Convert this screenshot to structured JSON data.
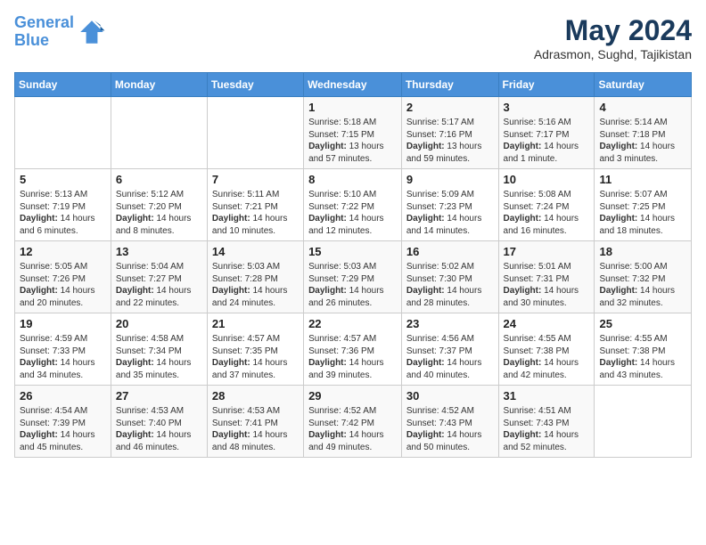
{
  "header": {
    "logo_line1": "General",
    "logo_line2": "Blue",
    "month_year": "May 2024",
    "location": "Adrasmon, Sughd, Tajikistan"
  },
  "weekdays": [
    "Sunday",
    "Monday",
    "Tuesday",
    "Wednesday",
    "Thursday",
    "Friday",
    "Saturday"
  ],
  "weeks": [
    [
      {
        "day": "",
        "info": ""
      },
      {
        "day": "",
        "info": ""
      },
      {
        "day": "",
        "info": ""
      },
      {
        "day": "1",
        "info": "Sunrise: 5:18 AM\nSunset: 7:15 PM\nDaylight: 13 hours and 57 minutes."
      },
      {
        "day": "2",
        "info": "Sunrise: 5:17 AM\nSunset: 7:16 PM\nDaylight: 13 hours and 59 minutes."
      },
      {
        "day": "3",
        "info": "Sunrise: 5:16 AM\nSunset: 7:17 PM\nDaylight: 14 hours and 1 minute."
      },
      {
        "day": "4",
        "info": "Sunrise: 5:14 AM\nSunset: 7:18 PM\nDaylight: 14 hours and 3 minutes."
      }
    ],
    [
      {
        "day": "5",
        "info": "Sunrise: 5:13 AM\nSunset: 7:19 PM\nDaylight: 14 hours and 6 minutes."
      },
      {
        "day": "6",
        "info": "Sunrise: 5:12 AM\nSunset: 7:20 PM\nDaylight: 14 hours and 8 minutes."
      },
      {
        "day": "7",
        "info": "Sunrise: 5:11 AM\nSunset: 7:21 PM\nDaylight: 14 hours and 10 minutes."
      },
      {
        "day": "8",
        "info": "Sunrise: 5:10 AM\nSunset: 7:22 PM\nDaylight: 14 hours and 12 minutes."
      },
      {
        "day": "9",
        "info": "Sunrise: 5:09 AM\nSunset: 7:23 PM\nDaylight: 14 hours and 14 minutes."
      },
      {
        "day": "10",
        "info": "Sunrise: 5:08 AM\nSunset: 7:24 PM\nDaylight: 14 hours and 16 minutes."
      },
      {
        "day": "11",
        "info": "Sunrise: 5:07 AM\nSunset: 7:25 PM\nDaylight: 14 hours and 18 minutes."
      }
    ],
    [
      {
        "day": "12",
        "info": "Sunrise: 5:05 AM\nSunset: 7:26 PM\nDaylight: 14 hours and 20 minutes."
      },
      {
        "day": "13",
        "info": "Sunrise: 5:04 AM\nSunset: 7:27 PM\nDaylight: 14 hours and 22 minutes."
      },
      {
        "day": "14",
        "info": "Sunrise: 5:03 AM\nSunset: 7:28 PM\nDaylight: 14 hours and 24 minutes."
      },
      {
        "day": "15",
        "info": "Sunrise: 5:03 AM\nSunset: 7:29 PM\nDaylight: 14 hours and 26 minutes."
      },
      {
        "day": "16",
        "info": "Sunrise: 5:02 AM\nSunset: 7:30 PM\nDaylight: 14 hours and 28 minutes."
      },
      {
        "day": "17",
        "info": "Sunrise: 5:01 AM\nSunset: 7:31 PM\nDaylight: 14 hours and 30 minutes."
      },
      {
        "day": "18",
        "info": "Sunrise: 5:00 AM\nSunset: 7:32 PM\nDaylight: 14 hours and 32 minutes."
      }
    ],
    [
      {
        "day": "19",
        "info": "Sunrise: 4:59 AM\nSunset: 7:33 PM\nDaylight: 14 hours and 34 minutes."
      },
      {
        "day": "20",
        "info": "Sunrise: 4:58 AM\nSunset: 7:34 PM\nDaylight: 14 hours and 35 minutes."
      },
      {
        "day": "21",
        "info": "Sunrise: 4:57 AM\nSunset: 7:35 PM\nDaylight: 14 hours and 37 minutes."
      },
      {
        "day": "22",
        "info": "Sunrise: 4:57 AM\nSunset: 7:36 PM\nDaylight: 14 hours and 39 minutes."
      },
      {
        "day": "23",
        "info": "Sunrise: 4:56 AM\nSunset: 7:37 PM\nDaylight: 14 hours and 40 minutes."
      },
      {
        "day": "24",
        "info": "Sunrise: 4:55 AM\nSunset: 7:38 PM\nDaylight: 14 hours and 42 minutes."
      },
      {
        "day": "25",
        "info": "Sunrise: 4:55 AM\nSunset: 7:38 PM\nDaylight: 14 hours and 43 minutes."
      }
    ],
    [
      {
        "day": "26",
        "info": "Sunrise: 4:54 AM\nSunset: 7:39 PM\nDaylight: 14 hours and 45 minutes."
      },
      {
        "day": "27",
        "info": "Sunrise: 4:53 AM\nSunset: 7:40 PM\nDaylight: 14 hours and 46 minutes."
      },
      {
        "day": "28",
        "info": "Sunrise: 4:53 AM\nSunset: 7:41 PM\nDaylight: 14 hours and 48 minutes."
      },
      {
        "day": "29",
        "info": "Sunrise: 4:52 AM\nSunset: 7:42 PM\nDaylight: 14 hours and 49 minutes."
      },
      {
        "day": "30",
        "info": "Sunrise: 4:52 AM\nSunset: 7:43 PM\nDaylight: 14 hours and 50 minutes."
      },
      {
        "day": "31",
        "info": "Sunrise: 4:51 AM\nSunset: 7:43 PM\nDaylight: 14 hours and 52 minutes."
      },
      {
        "day": "",
        "info": ""
      }
    ]
  ]
}
